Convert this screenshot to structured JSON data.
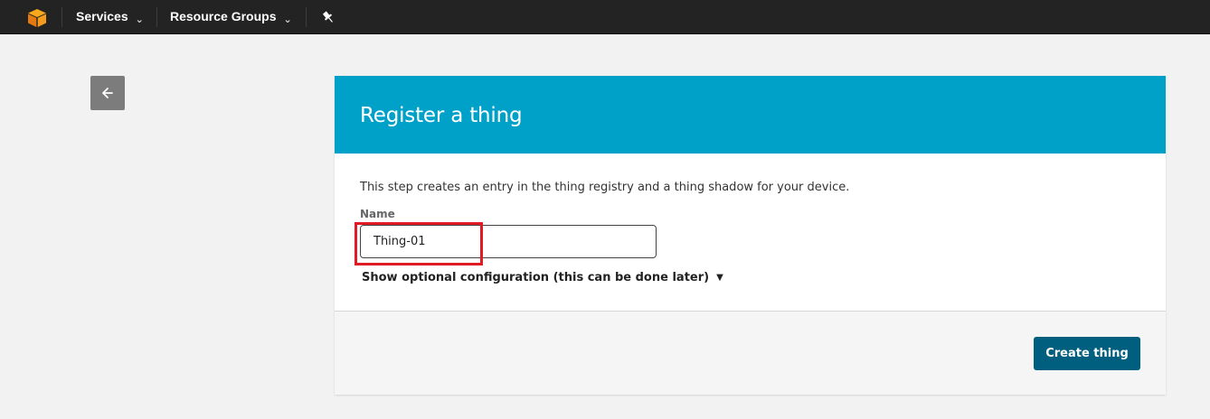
{
  "topbar": {
    "logo_icon": "aws-cube-icon",
    "services_label": "Services",
    "resource_groups_label": "Resource Groups",
    "pin_icon": "pushpin-icon"
  },
  "back_button": {
    "icon": "arrow-left-icon"
  },
  "register": {
    "title": "Register a thing",
    "description": "This step creates an entry in the thing registry and a thing shadow for your device.",
    "name_label": "Name",
    "name_value": "Thing-01",
    "optional_config_label": "Show optional configuration (this can be done later)",
    "create_button_label": "Create thing"
  },
  "colors": {
    "header_bg": "#00a1c9",
    "button_bg": "#005f7f",
    "highlight_border": "#e01b24",
    "topbar_bg": "#232323"
  }
}
